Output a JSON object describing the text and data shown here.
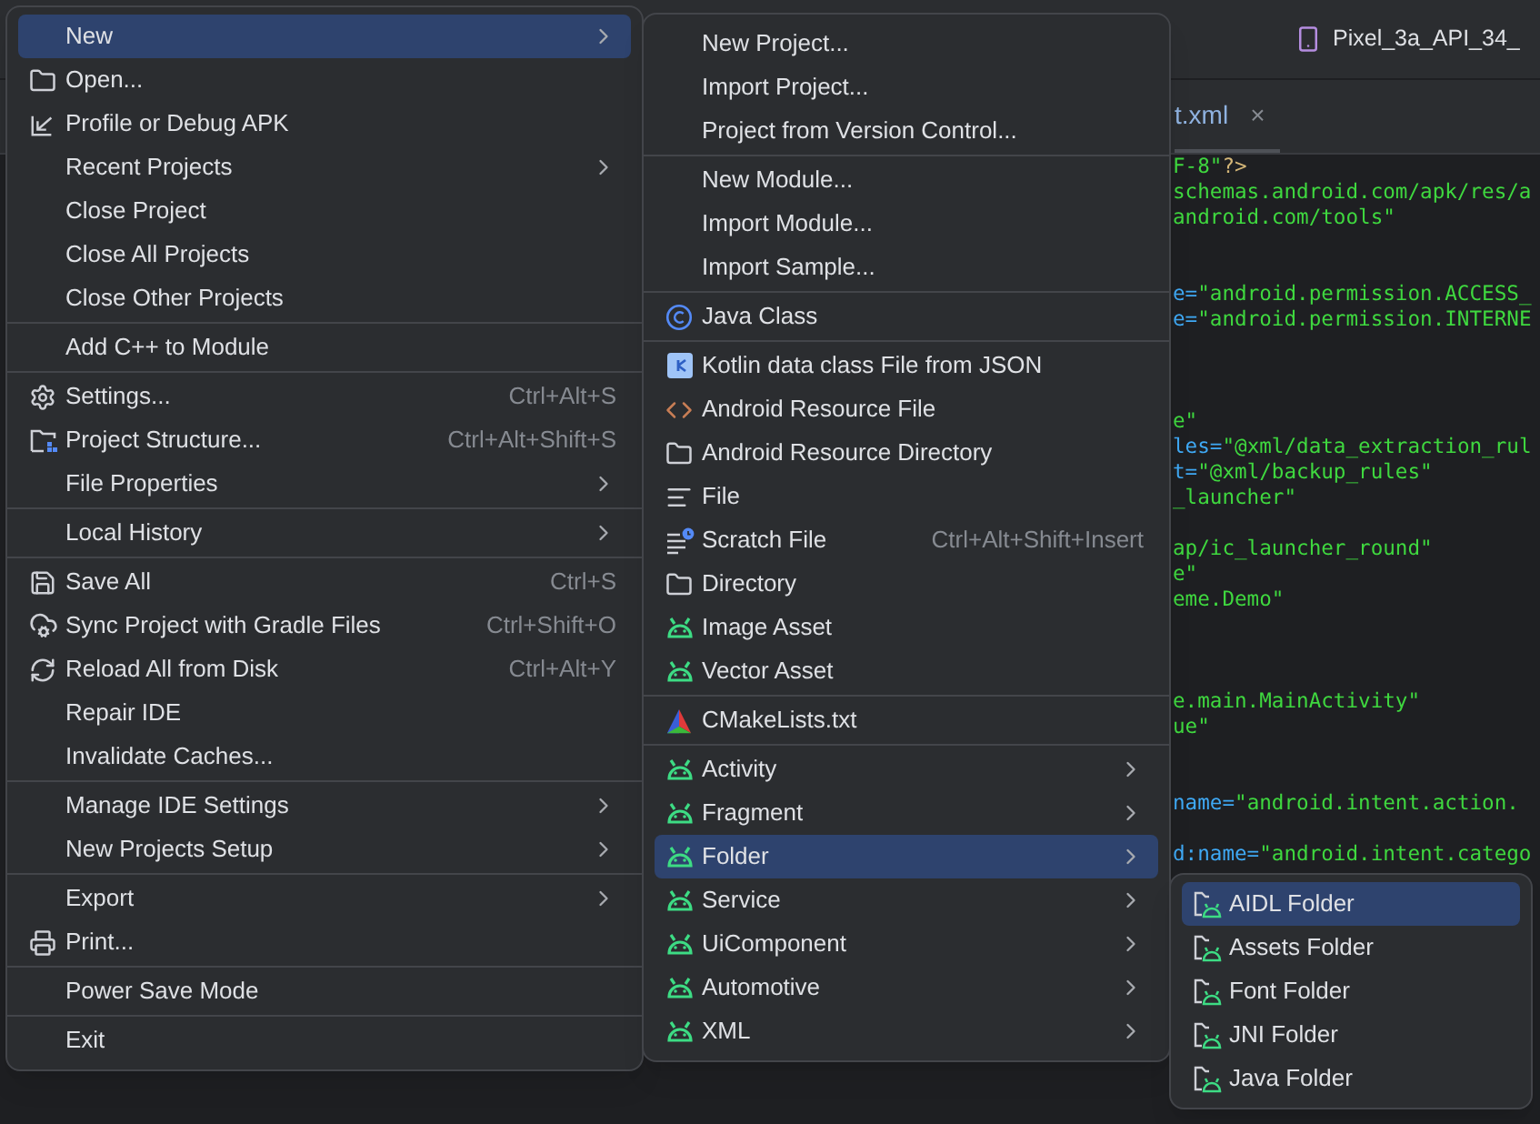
{
  "toolbar": {
    "device": "Pixel_3a_API_34_"
  },
  "editor_tab": {
    "label": "t.xml",
    "close": "×"
  },
  "code_lines": [
    {
      "kind": "code",
      "segments": [
        {
          "kind": "value",
          "text": "F-8\""
        },
        {
          "kind": "tag",
          "text": "?>"
        }
      ]
    },
    {
      "kind": "code",
      "segments": [
        {
          "kind": "value",
          "text": "schemas.android.com/apk/res/a"
        }
      ]
    },
    {
      "kind": "code",
      "segments": [
        {
          "kind": "value",
          "text": "android.com/tools\""
        }
      ]
    },
    {
      "kind": "blank"
    },
    {
      "kind": "blank"
    },
    {
      "kind": "code",
      "segments": [
        {
          "kind": "attr",
          "text": "e="
        },
        {
          "kind": "value",
          "text": "\"android.permission.ACCESS_"
        }
      ]
    },
    {
      "kind": "code",
      "segments": [
        {
          "kind": "attr",
          "text": "e="
        },
        {
          "kind": "value",
          "text": "\"android.permission.INTERNE"
        }
      ]
    },
    {
      "kind": "blank"
    },
    {
      "kind": "blank"
    },
    {
      "kind": "blank"
    },
    {
      "kind": "code",
      "segments": [
        {
          "kind": "value",
          "text": "e\""
        }
      ]
    },
    {
      "kind": "code",
      "segments": [
        {
          "kind": "attr",
          "text": "les="
        },
        {
          "kind": "value",
          "text": "\"@xml/data_extraction_rul"
        }
      ]
    },
    {
      "kind": "code",
      "segments": [
        {
          "kind": "attr",
          "text": "t="
        },
        {
          "kind": "value",
          "text": "\"@xml/backup_rules\""
        }
      ]
    },
    {
      "kind": "code",
      "segments": [
        {
          "kind": "value",
          "text": "_launcher\""
        }
      ]
    },
    {
      "kind": "blank"
    },
    {
      "kind": "code",
      "segments": [
        {
          "kind": "value",
          "text": "ap/ic_launcher_round\""
        }
      ]
    },
    {
      "kind": "code",
      "segments": [
        {
          "kind": "value",
          "text": "e\""
        }
      ]
    },
    {
      "kind": "code",
      "segments": [
        {
          "kind": "value",
          "text": "eme.Demo\""
        }
      ]
    },
    {
      "kind": "blank"
    },
    {
      "kind": "blank"
    },
    {
      "kind": "blank"
    },
    {
      "kind": "code",
      "segments": [
        {
          "kind": "value",
          "text": "e.main.MainActivity\""
        }
      ]
    },
    {
      "kind": "code",
      "segments": [
        {
          "kind": "value",
          "text": "ue\""
        }
      ]
    },
    {
      "kind": "blank"
    },
    {
      "kind": "blank"
    },
    {
      "kind": "code",
      "segments": [
        {
          "kind": "attr",
          "text": "name="
        },
        {
          "kind": "value",
          "text": "\"android.intent.action."
        }
      ]
    },
    {
      "kind": "blank"
    },
    {
      "kind": "code",
      "segments": [
        {
          "kind": "attr",
          "text": "d:name="
        },
        {
          "kind": "value",
          "text": "\"android.intent.catego"
        }
      ]
    }
  ],
  "file_menu": [
    {
      "kind": "item",
      "label": "New",
      "selected": true,
      "submenu": true
    },
    {
      "kind": "item",
      "label": "Open...",
      "selected": false,
      "submenu": false
    },
    {
      "kind": "item",
      "label": "Profile or Debug APK",
      "selected": false,
      "submenu": false
    },
    {
      "kind": "item",
      "label": "Recent Projects",
      "selected": false,
      "submenu": true
    },
    {
      "kind": "item",
      "label": "Close Project",
      "selected": false,
      "submenu": false
    },
    {
      "kind": "item",
      "label": "Close All Projects",
      "selected": false,
      "submenu": false
    },
    {
      "kind": "item",
      "label": "Close Other Projects",
      "selected": false,
      "submenu": false
    },
    {
      "kind": "separator"
    },
    {
      "kind": "item",
      "label": "Add C++ to Module",
      "selected": false,
      "submenu": false
    },
    {
      "kind": "separator"
    },
    {
      "kind": "item",
      "label": "Settings...",
      "selected": false,
      "submenu": false,
      "shortcut": "Ctrl+Alt+S"
    },
    {
      "kind": "item",
      "label": "Project Structure...",
      "selected": false,
      "submenu": false,
      "shortcut": "Ctrl+Alt+Shift+S"
    },
    {
      "kind": "item",
      "label": "File Properties",
      "selected": false,
      "submenu": true
    },
    {
      "kind": "separator"
    },
    {
      "kind": "item",
      "label": "Local History",
      "selected": false,
      "submenu": true
    },
    {
      "kind": "separator"
    },
    {
      "kind": "item",
      "label": "Save All",
      "selected": false,
      "submenu": false,
      "shortcut": "Ctrl+S"
    },
    {
      "kind": "item",
      "label": "Sync Project with Gradle Files",
      "selected": false,
      "submenu": false,
      "shortcut": "Ctrl+Shift+O"
    },
    {
      "kind": "item",
      "label": "Reload All from Disk",
      "selected": false,
      "submenu": false,
      "shortcut": "Ctrl+Alt+Y"
    },
    {
      "kind": "item",
      "label": "Repair IDE",
      "selected": false,
      "submenu": false
    },
    {
      "kind": "item",
      "label": "Invalidate Caches...",
      "selected": false,
      "submenu": false
    },
    {
      "kind": "separator"
    },
    {
      "kind": "item",
      "label": "Manage IDE Settings",
      "selected": false,
      "submenu": true
    },
    {
      "kind": "item",
      "label": "New Projects Setup",
      "selected": false,
      "submenu": true
    },
    {
      "kind": "separator"
    },
    {
      "kind": "item",
      "label": "Export",
      "selected": false,
      "submenu": true
    },
    {
      "kind": "item",
      "label": "Print...",
      "selected": false,
      "submenu": false
    },
    {
      "kind": "separator"
    },
    {
      "kind": "item",
      "label": "Power Save Mode",
      "selected": false,
      "submenu": false
    },
    {
      "kind": "separator"
    },
    {
      "kind": "item",
      "label": "Exit",
      "selected": false,
      "submenu": false
    }
  ],
  "new_menu": [
    {
      "kind": "item",
      "label": "New Project...",
      "selected": false,
      "submenu": false
    },
    {
      "kind": "item",
      "label": "Import Project...",
      "selected": false,
      "submenu": false
    },
    {
      "kind": "item",
      "label": "Project from Version Control...",
      "selected": false,
      "submenu": false
    },
    {
      "kind": "separator"
    },
    {
      "kind": "item",
      "label": "New Module...",
      "selected": false,
      "submenu": false
    },
    {
      "kind": "item",
      "label": "Import Module...",
      "selected": false,
      "submenu": false
    },
    {
      "kind": "item",
      "label": "Import Sample...",
      "selected": false,
      "submenu": false
    },
    {
      "kind": "separator"
    },
    {
      "kind": "item",
      "label": "Java Class",
      "selected": false,
      "submenu": false
    },
    {
      "kind": "separator"
    },
    {
      "kind": "item",
      "label": "Kotlin data class File from JSON",
      "selected": false,
      "submenu": false
    },
    {
      "kind": "item",
      "label": "Android Resource File",
      "selected": false,
      "submenu": false
    },
    {
      "kind": "item",
      "label": "Android Resource Directory",
      "selected": false,
      "submenu": false
    },
    {
      "kind": "item",
      "label": "File",
      "selected": false,
      "submenu": false
    },
    {
      "kind": "item",
      "label": "Scratch File",
      "selected": false,
      "submenu": false,
      "shortcut": "Ctrl+Alt+Shift+Insert"
    },
    {
      "kind": "item",
      "label": "Directory",
      "selected": false,
      "submenu": false
    },
    {
      "kind": "item",
      "label": "Image Asset",
      "selected": false,
      "submenu": false
    },
    {
      "kind": "item",
      "label": "Vector Asset",
      "selected": false,
      "submenu": false
    },
    {
      "kind": "separator"
    },
    {
      "kind": "item",
      "label": "CMakeLists.txt",
      "selected": false,
      "submenu": false
    },
    {
      "kind": "separator"
    },
    {
      "kind": "item",
      "label": "Activity",
      "selected": false,
      "submenu": true
    },
    {
      "kind": "item",
      "label": "Fragment",
      "selected": false,
      "submenu": true
    },
    {
      "kind": "item",
      "label": "Folder",
      "selected": true,
      "submenu": true
    },
    {
      "kind": "item",
      "label": "Service",
      "selected": false,
      "submenu": true
    },
    {
      "kind": "item",
      "label": "UiComponent",
      "selected": false,
      "submenu": true
    },
    {
      "kind": "item",
      "label": "Automotive",
      "selected": false,
      "submenu": true
    },
    {
      "kind": "item",
      "label": "XML",
      "selected": false,
      "submenu": true
    }
  ],
  "folder_menu": [
    {
      "kind": "item",
      "label": "AIDL Folder",
      "selected": true,
      "submenu": false
    },
    {
      "kind": "item",
      "label": "Assets Folder",
      "selected": false,
      "submenu": false
    },
    {
      "kind": "item",
      "label": "Font Folder",
      "selected": false,
      "submenu": false
    },
    {
      "kind": "item",
      "label": "JNI Folder",
      "selected": false,
      "submenu": false
    },
    {
      "kind": "item",
      "label": "Java Folder",
      "selected": false,
      "submenu": false
    }
  ]
}
